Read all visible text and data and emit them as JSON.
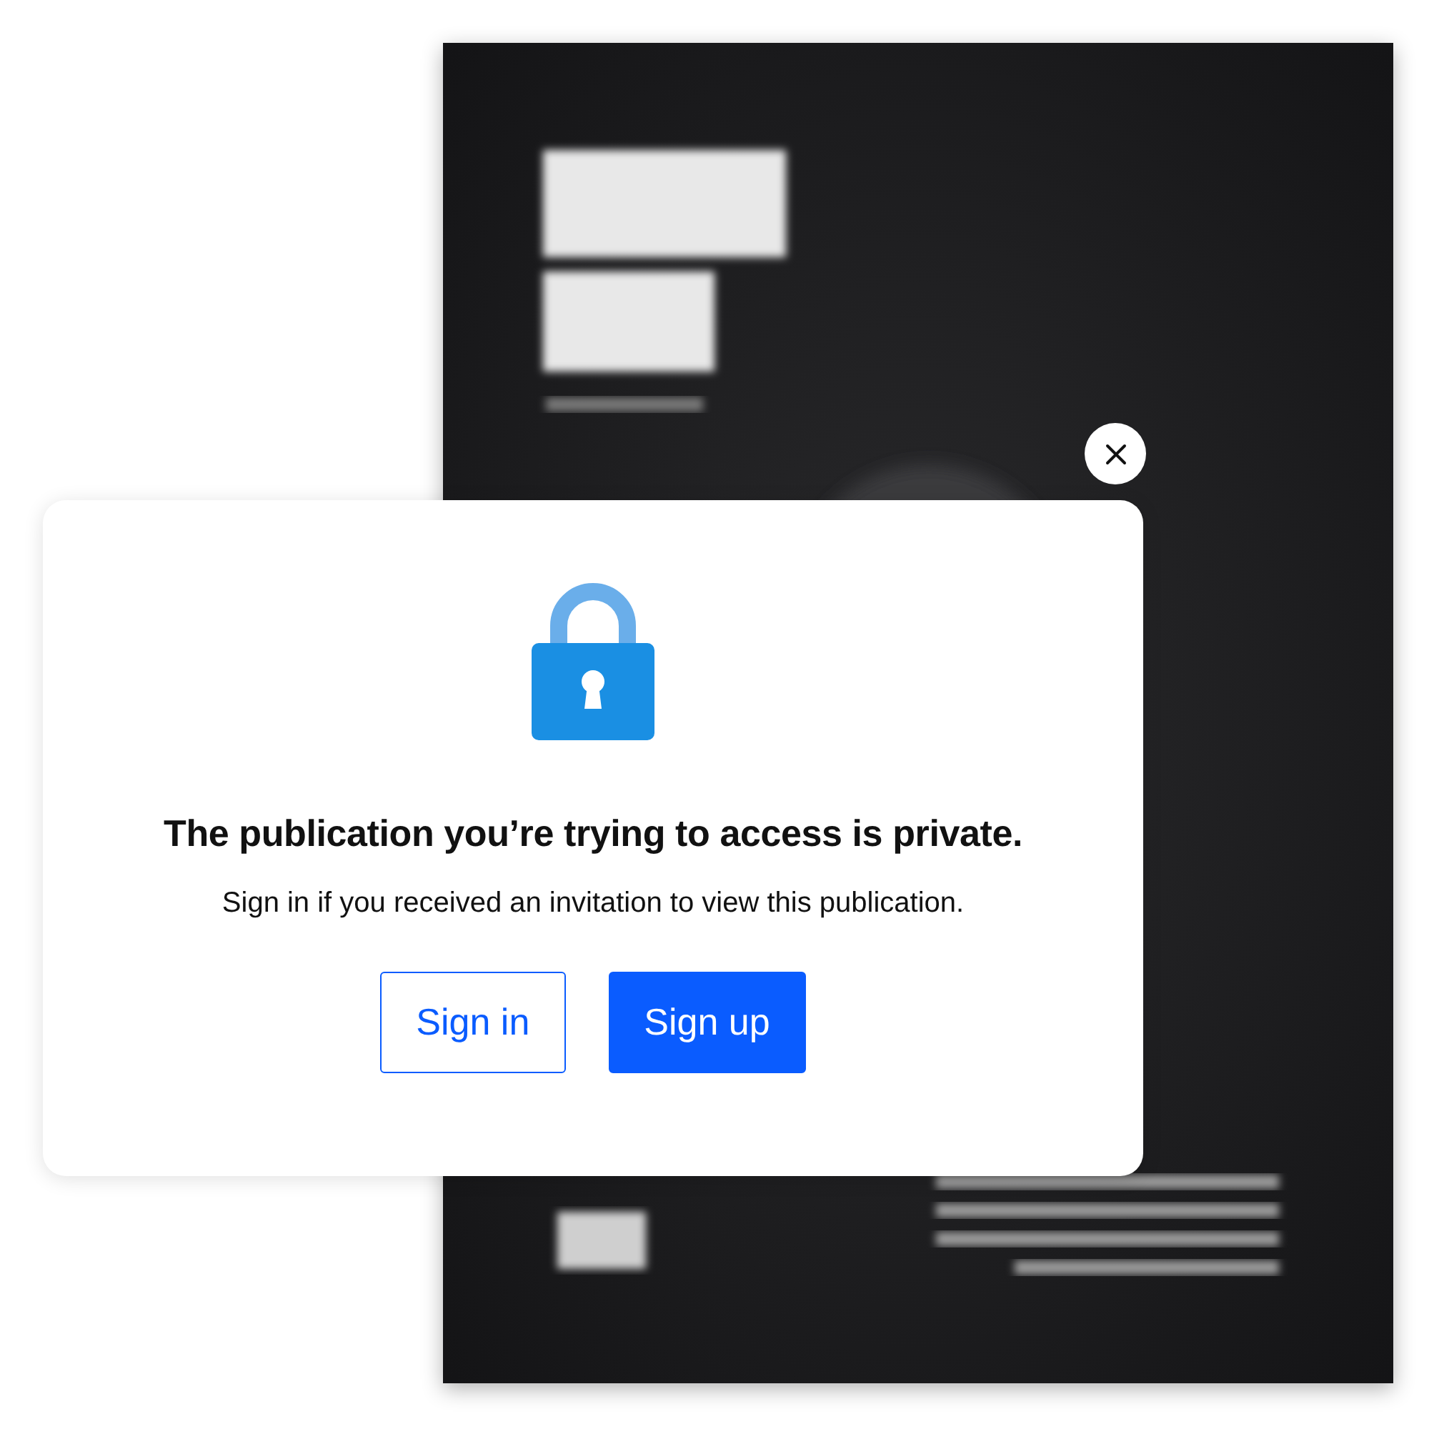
{
  "dialog": {
    "title": "The publication you’re trying to access is private.",
    "message": "Sign in if you received an invitation to view this publication.",
    "buttons": [
      {
        "label": "Sign in",
        "kind": "outline"
      },
      {
        "label": "Sign up",
        "kind": "primary"
      }
    ]
  }
}
